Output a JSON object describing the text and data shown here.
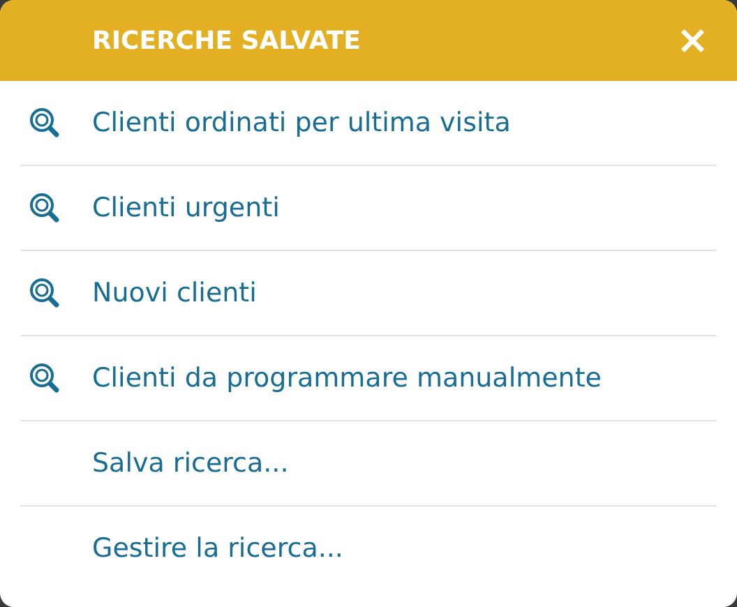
{
  "header": {
    "title": "RICERCHE SALVATE",
    "close": "×"
  },
  "items": [
    {
      "kind": "saved_search",
      "label": "Clienti ordinati per ultima visita"
    },
    {
      "kind": "saved_search",
      "label": "Clienti urgenti"
    },
    {
      "kind": "saved_search",
      "label": "Nuovi clienti"
    },
    {
      "kind": "saved_search",
      "label": "Clienti da programmare manualmente"
    },
    {
      "kind": "action",
      "label": "Salva ricerca..."
    },
    {
      "kind": "action",
      "label": "Gestire la ricerca..."
    }
  ]
}
